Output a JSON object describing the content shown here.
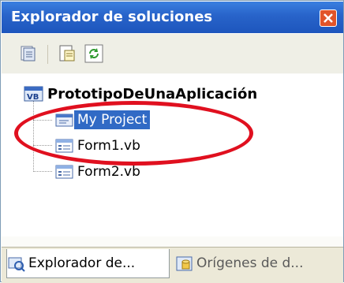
{
  "window": {
    "title": "Explorador de soluciones"
  },
  "toolbar": {
    "buttons": [
      {
        "icon": "show-all-files-icon"
      },
      {
        "icon": "properties-icon"
      },
      {
        "icon": "refresh-icon"
      }
    ]
  },
  "tree": {
    "root": {
      "label": "PrototipoDeUnaAplicación",
      "icon": "vb-solution-icon"
    },
    "items": [
      {
        "label": "My Project",
        "icon": "my-project-icon",
        "selected": true
      },
      {
        "label": "Form1.vb",
        "icon": "form-icon",
        "selected": false
      },
      {
        "label": "Form2.vb",
        "icon": "form-icon",
        "selected": false
      }
    ]
  },
  "tabs": [
    {
      "label": "Explorador de...",
      "icon": "solution-explorer-icon",
      "active": true
    },
    {
      "label": "Orígenes de d...",
      "icon": "data-sources-icon",
      "active": false
    }
  ],
  "colors": {
    "titlebar": "#2863c9",
    "selection": "#316ac5",
    "annotation": "#e0101f"
  }
}
